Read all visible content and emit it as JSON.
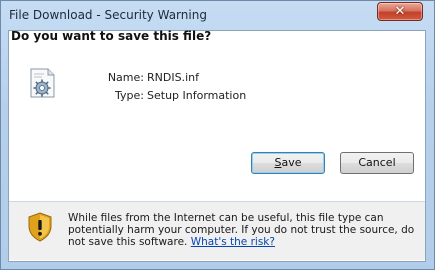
{
  "window": {
    "title": "File Download - Security Warning"
  },
  "titlebar": {
    "close_glyph": "✕"
  },
  "dialog": {
    "question": "Do you want to save this file?",
    "file": {
      "name_label": "Name:",
      "name_value": "RNDIS.inf",
      "type_label": "Type:",
      "type_value": "Setup Information"
    },
    "buttons": {
      "save_mnemonic": "S",
      "save_rest": "ave",
      "cancel_label": "Cancel"
    },
    "warning": {
      "text": "While files from the Internet can be useful, this file type can potentially harm your computer. If you do not trust the source, do not save this software.",
      "link_text": "What's the risk?"
    }
  },
  "icons": {
    "file": "setup-file-gear-icon",
    "warning": "security-shield-warning-icon",
    "close": "close-icon"
  },
  "colors": {
    "title_gradient_top": "#c5dcf3",
    "close_button_red": "#c2412a",
    "link_blue": "#0645ad",
    "warning_panel_bg": "#f0f0f0",
    "default_button_border": "#3c7fb1"
  }
}
